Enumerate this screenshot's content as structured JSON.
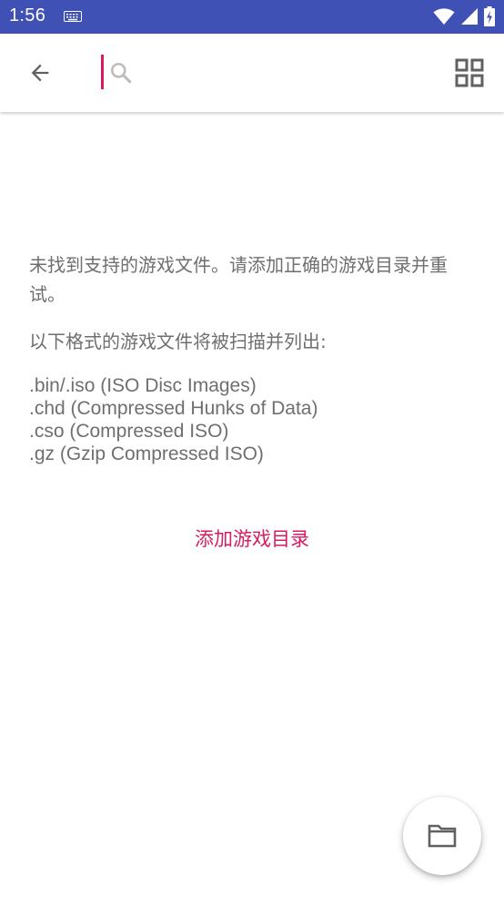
{
  "status_bar": {
    "time": "1:56",
    "icons": [
      "keyboard-icon",
      "wifi-icon",
      "signal-icon",
      "battery-charging-icon"
    ],
    "background": "#3f51b5"
  },
  "app_bar": {
    "back_icon": "arrow-back-icon",
    "search": {
      "value": "",
      "placeholder": "",
      "icon": "search-icon"
    },
    "view_toggle_icon": "grid-view-icon"
  },
  "main": {
    "empty_message": "未找到支持的游戏文件。请添加正确的游戏目录并重试。",
    "formats_intro": "以下格式的游戏文件将被扫描并列出:",
    "formats": [
      ".bin/.iso (ISO Disc Images)",
      ".chd (Compressed Hunks of Data)",
      ".cso (Compressed ISO)",
      ".gz (Gzip Compressed ISO)"
    ],
    "add_directory_label": "添加游戏目录"
  },
  "fab": {
    "icon": "folder-icon"
  },
  "colors": {
    "accent": "#d81b60",
    "primary": "#3f51b5",
    "text_secondary": "#6f6f6f"
  }
}
